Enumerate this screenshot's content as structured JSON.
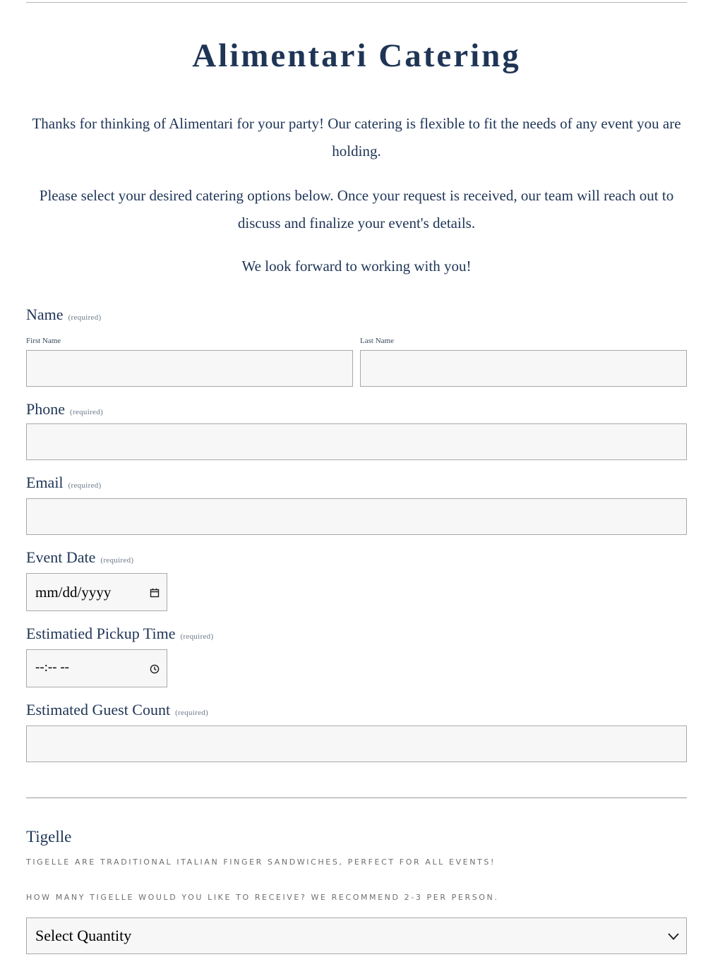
{
  "header": {
    "title": "Alimentari Catering"
  },
  "intro": {
    "p1": "Thanks for thinking of Alimentari for your party! Our catering is flexible to fit the needs of any event you are holding.",
    "p2": "Please select your desired catering options below. Once your request is received, our team will reach out to discuss and finalize your event's details.",
    "p3": "We look forward to working with you!"
  },
  "form": {
    "required_tag": "(required)",
    "name": {
      "label": "Name",
      "first_label": "First Name",
      "last_label": "Last Name",
      "first_value": "",
      "last_value": ""
    },
    "phone": {
      "label": "Phone",
      "value": ""
    },
    "email": {
      "label": "Email",
      "value": ""
    },
    "event_date": {
      "label": "Event Date",
      "placeholder": "mm/dd/yyyy",
      "icon": "calendar-icon"
    },
    "pickup_time": {
      "label": "Estimatied Pickup Time",
      "placeholder": "--:-- --",
      "icon": "clock-icon"
    },
    "guest_count": {
      "label": "Estimated Guest Count",
      "value": ""
    }
  },
  "tigelle": {
    "title": "Tigelle",
    "description": "Tigelle are traditional Italian finger sandwiches, perfect for all events!",
    "question": "How many tigelle would you like to receive? We recommend 2-3 per person.",
    "select_value": "Select Quantity",
    "icon": "chevron-down-icon"
  }
}
